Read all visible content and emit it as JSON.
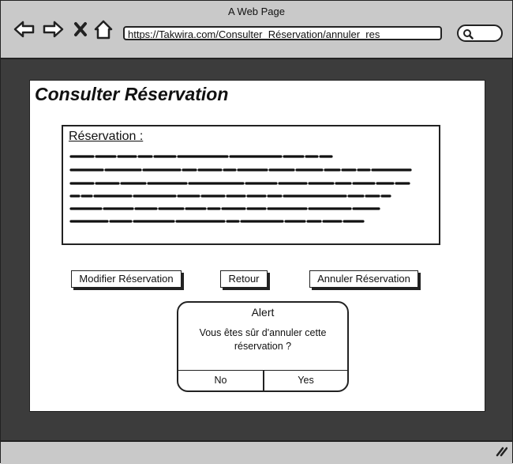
{
  "window": {
    "title": "A Web Page"
  },
  "nav": {
    "back_icon": "arrow-left-icon",
    "forward_icon": "arrow-right-icon",
    "stop_icon": "close-icon",
    "home_icon": "home-icon"
  },
  "address_bar": {
    "url": "https://Takwira.com/Consulter_Réservation/annuler_res"
  },
  "search": {
    "icon": "search-icon"
  },
  "page": {
    "title": "Consulter Réservation",
    "reservation_box": {
      "label": "Réservation :"
    }
  },
  "buttons": {
    "modify": "Modifier Réservation",
    "back": "Retour",
    "cancel": "Annuler Réservation"
  },
  "alert": {
    "title": "Alert",
    "message": "Vous êtes sûr d'annuler cette réservation ?",
    "no": "No",
    "yes": "Yes"
  },
  "colors": {
    "chrome": "#c9c9c9",
    "viewport": "#3c3c3c",
    "ink": "#222222",
    "page": "#ffffff"
  }
}
